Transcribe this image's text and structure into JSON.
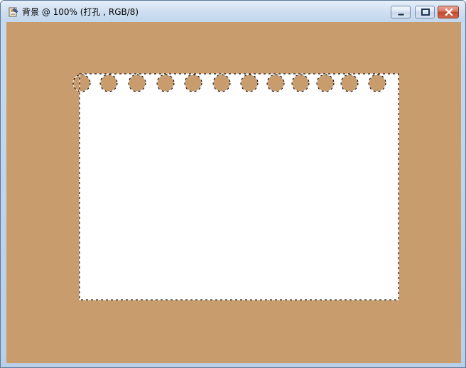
{
  "window": {
    "title": "背景 @ 100% (打孔 , RGB/8)"
  },
  "controls": {
    "minimize_icon": "minimize-icon",
    "maximize_icon": "maximize-icon",
    "close_icon": "close-icon"
  },
  "canvas": {
    "background_color": "#c89c6c",
    "paper_color": "#ffffff",
    "hole_color": "#c89c6c",
    "hole_count": 12
  }
}
